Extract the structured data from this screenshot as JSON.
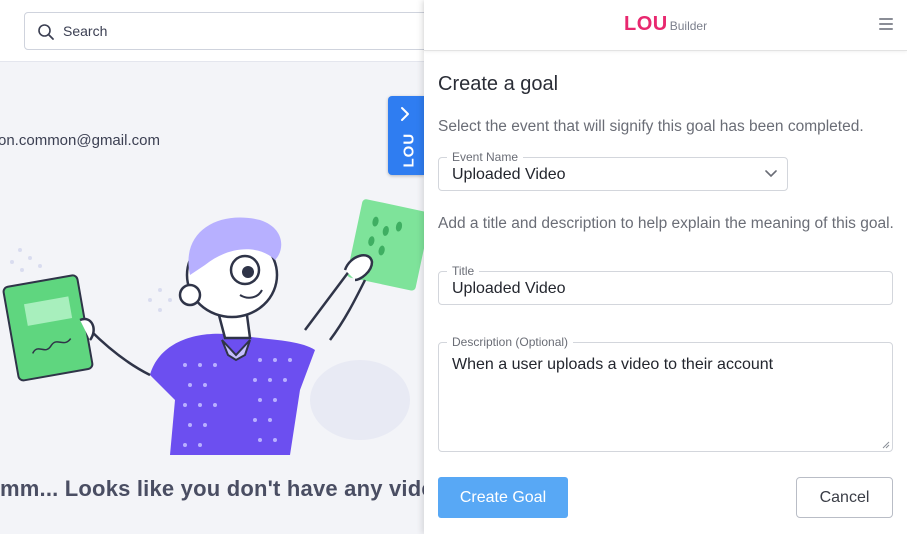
{
  "background": {
    "search": {
      "placeholder": "Search"
    },
    "email_text": "on.common@gmail.com",
    "empty_message": "mm... Looks like you don't have any vide",
    "lou_tab_label": "LOU"
  },
  "panel": {
    "brand": {
      "name": "LOU",
      "suffix": "Builder"
    },
    "title": "Create a goal",
    "event_help": "Select the event that will signify this goal has been completed.",
    "event_field": {
      "label": "Event Name",
      "value": "Uploaded Video"
    },
    "title_help": "Add a title and description to help explain the meaning of this goal.",
    "title_field": {
      "label": "Title",
      "value": "Uploaded Video"
    },
    "description_field": {
      "label": "Description (Optional)",
      "value": "When a user uploads a video to their account"
    },
    "create_button": "Create Goal",
    "cancel_button": "Cancel"
  },
  "colors": {
    "brand": "#e8286f",
    "primary_button": "#58a8f5",
    "lou_tab": "#2f7df1"
  },
  "icons": [
    "search-icon",
    "chevron-right-icon",
    "hamburger-menu-icon",
    "chevron-down-icon",
    "resize-handle-icon"
  ]
}
